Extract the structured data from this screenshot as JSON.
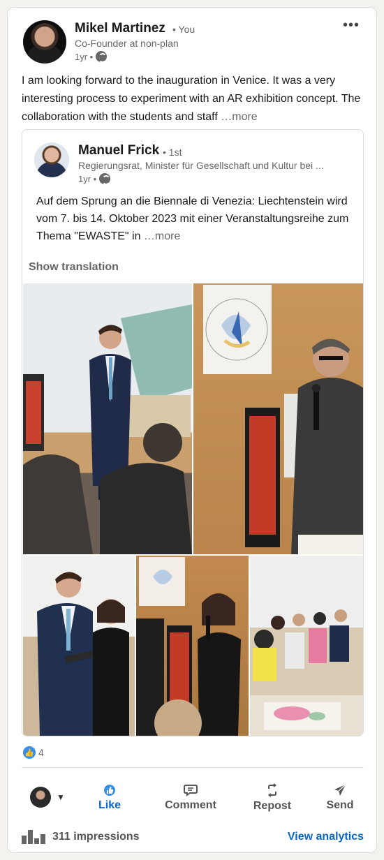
{
  "post": {
    "author": {
      "name": "Mikel Martinez",
      "badge": "• You",
      "subtitle": "Co-Founder at non-plan",
      "time": "1yr •"
    },
    "menu_icon": "more-horizontal-icon",
    "text": "I am looking forward to the inauguration in Venice. It was a very interesting process to experiment with an AR exhibition concept. The collaboration with the students and staff",
    "more_label": "…more"
  },
  "reshare": {
    "author": {
      "name": "Manuel Frick",
      "degree": "• 1st",
      "subtitle": "Regierungsrat, Minister für Gesellschaft und Kultur bei ...",
      "time": "1yr •"
    },
    "text": "Auf dem Sprung an die Biennale di Venezia: Liechtenstein wird vom 7. bis 14. Oktober 2023 mit einer Veranstaltungsreihe zum Thema \"EWASTE\" in",
    "more_label": "…more",
    "show_translation": "Show translation"
  },
  "reactions": {
    "icon": "like-reaction-icon",
    "count": "4"
  },
  "actions": {
    "like": "Like",
    "comment": "Comment",
    "repost": "Repost",
    "send": "Send"
  },
  "footer": {
    "impressions": "311 impressions",
    "analytics": "View analytics"
  },
  "colors": {
    "accent": "#0a66c2",
    "like_badge": "#378fe9",
    "background": "#f4f2ee"
  }
}
